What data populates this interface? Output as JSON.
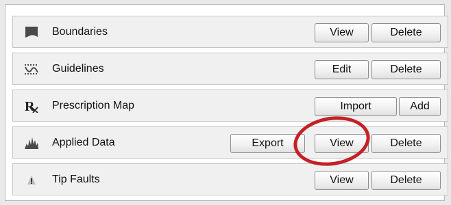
{
  "rows": [
    {
      "label": "Boundaries",
      "icon": "boundary-icon",
      "buttons": [
        "View",
        "Delete"
      ]
    },
    {
      "label": "Guidelines",
      "icon": "guideline-icon",
      "buttons": [
        "Edit",
        "Delete"
      ]
    },
    {
      "label": "Prescription Map",
      "icon": "prescription-icon",
      "buttons": [
        "Import",
        "Add"
      ]
    },
    {
      "label": "Applied Data",
      "icon": "applied-data-icon",
      "buttons": [
        "Export",
        "View",
        "Delete"
      ]
    },
    {
      "label": "Tip Faults",
      "icon": "warning-icon",
      "buttons": [
        "View",
        "Delete"
      ]
    }
  ],
  "colors": {
    "highlight": "#c42127",
    "row_background": "#f0f0f0",
    "icon": "#4a4a4a"
  }
}
